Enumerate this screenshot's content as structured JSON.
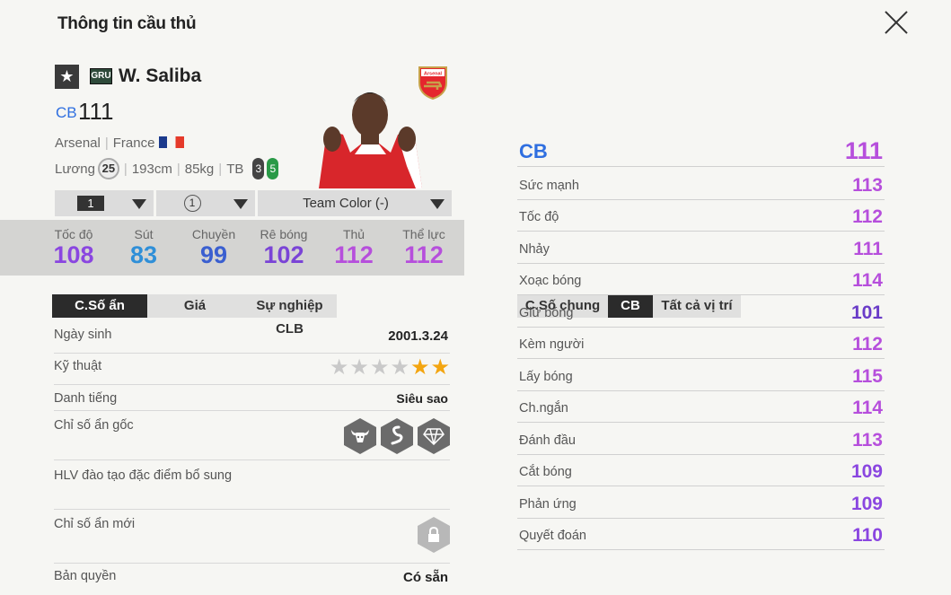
{
  "header": {
    "title": "Thông tin cầu thủ"
  },
  "player": {
    "season_badge": "GRU",
    "name": "W. Saliba",
    "position": "CB",
    "overall": "111",
    "club": "Arsenal",
    "nation": "France",
    "salary_label": "Lương",
    "salary": "25",
    "height": "193cm",
    "weight": "85kg",
    "body_type": "TB",
    "weak_foot_left": "3",
    "weak_foot_right": "5"
  },
  "selectors": {
    "level": "1",
    "team_color_level": "1",
    "team_color": "Team Color (-)"
  },
  "main_stats": [
    {
      "label": "Tốc độ",
      "value": "108",
      "color": "#8a46e0"
    },
    {
      "label": "Sút",
      "value": "83",
      "color": "#2f8fd8"
    },
    {
      "label": "Chuyền",
      "value": "99",
      "color": "#3a5fd0"
    },
    {
      "label": "Rê bóng",
      "value": "102",
      "color": "#7a44d6"
    },
    {
      "label": "Thủ",
      "value": "112",
      "color": "#b64fdc"
    },
    {
      "label": "Thể lực",
      "value": "112",
      "color": "#b64fdc"
    }
  ],
  "left_tabs": [
    "C.Số ẩn",
    "Giá",
    "Sự nghiệp CLB"
  ],
  "details": {
    "birth_label": "Ngày sinh",
    "birth": "2001.3.24",
    "skill_label": "Kỹ thuật",
    "skill_stars": 2,
    "skill_max": 6,
    "fame_label": "Danh tiếng",
    "fame": "Siêu sao",
    "traits_label": "Chỉ số ẩn gốc",
    "trait_icons": [
      "bull-icon",
      "snake-icon",
      "diamond-icon"
    ],
    "coach_label": "HLV đào tạo đặc điểm bổ sung",
    "new_traits_label": "Chỉ số ẩn mới",
    "lock_icon": "lock-icon",
    "license_label": "Bản quyền",
    "license": "Có sẵn"
  },
  "right_tabs": [
    "C.Số chung",
    "CB",
    "Tất cả vị trí"
  ],
  "position_rating": {
    "position": "CB",
    "value": "111"
  },
  "position_stats": [
    {
      "label": "Sức mạnh",
      "value": "113",
      "color": "#b64fdc"
    },
    {
      "label": "Tốc độ",
      "value": "112",
      "color": "#b64fdc"
    },
    {
      "label": "Nhảy",
      "value": "111",
      "color": "#b64fdc"
    },
    {
      "label": "Xoạc bóng",
      "value": "114",
      "color": "#b64fdc"
    },
    {
      "label": "Giữ bóng",
      "value": "101",
      "color": "#6a3cc8"
    },
    {
      "label": "Kèm người",
      "value": "112",
      "color": "#b64fdc"
    },
    {
      "label": "Lấy bóng",
      "value": "115",
      "color": "#b64fdc"
    },
    {
      "label": "Ch.ngắn",
      "value": "114",
      "color": "#b64fdc"
    },
    {
      "label": "Đánh đầu",
      "value": "113",
      "color": "#b64fdc"
    },
    {
      "label": "Cắt bóng",
      "value": "109",
      "color": "#8a46e0"
    },
    {
      "label": "Phản ứng",
      "value": "109",
      "color": "#8a46e0"
    },
    {
      "label": "Quyết đoán",
      "value": "110",
      "color": "#8a46e0"
    }
  ]
}
